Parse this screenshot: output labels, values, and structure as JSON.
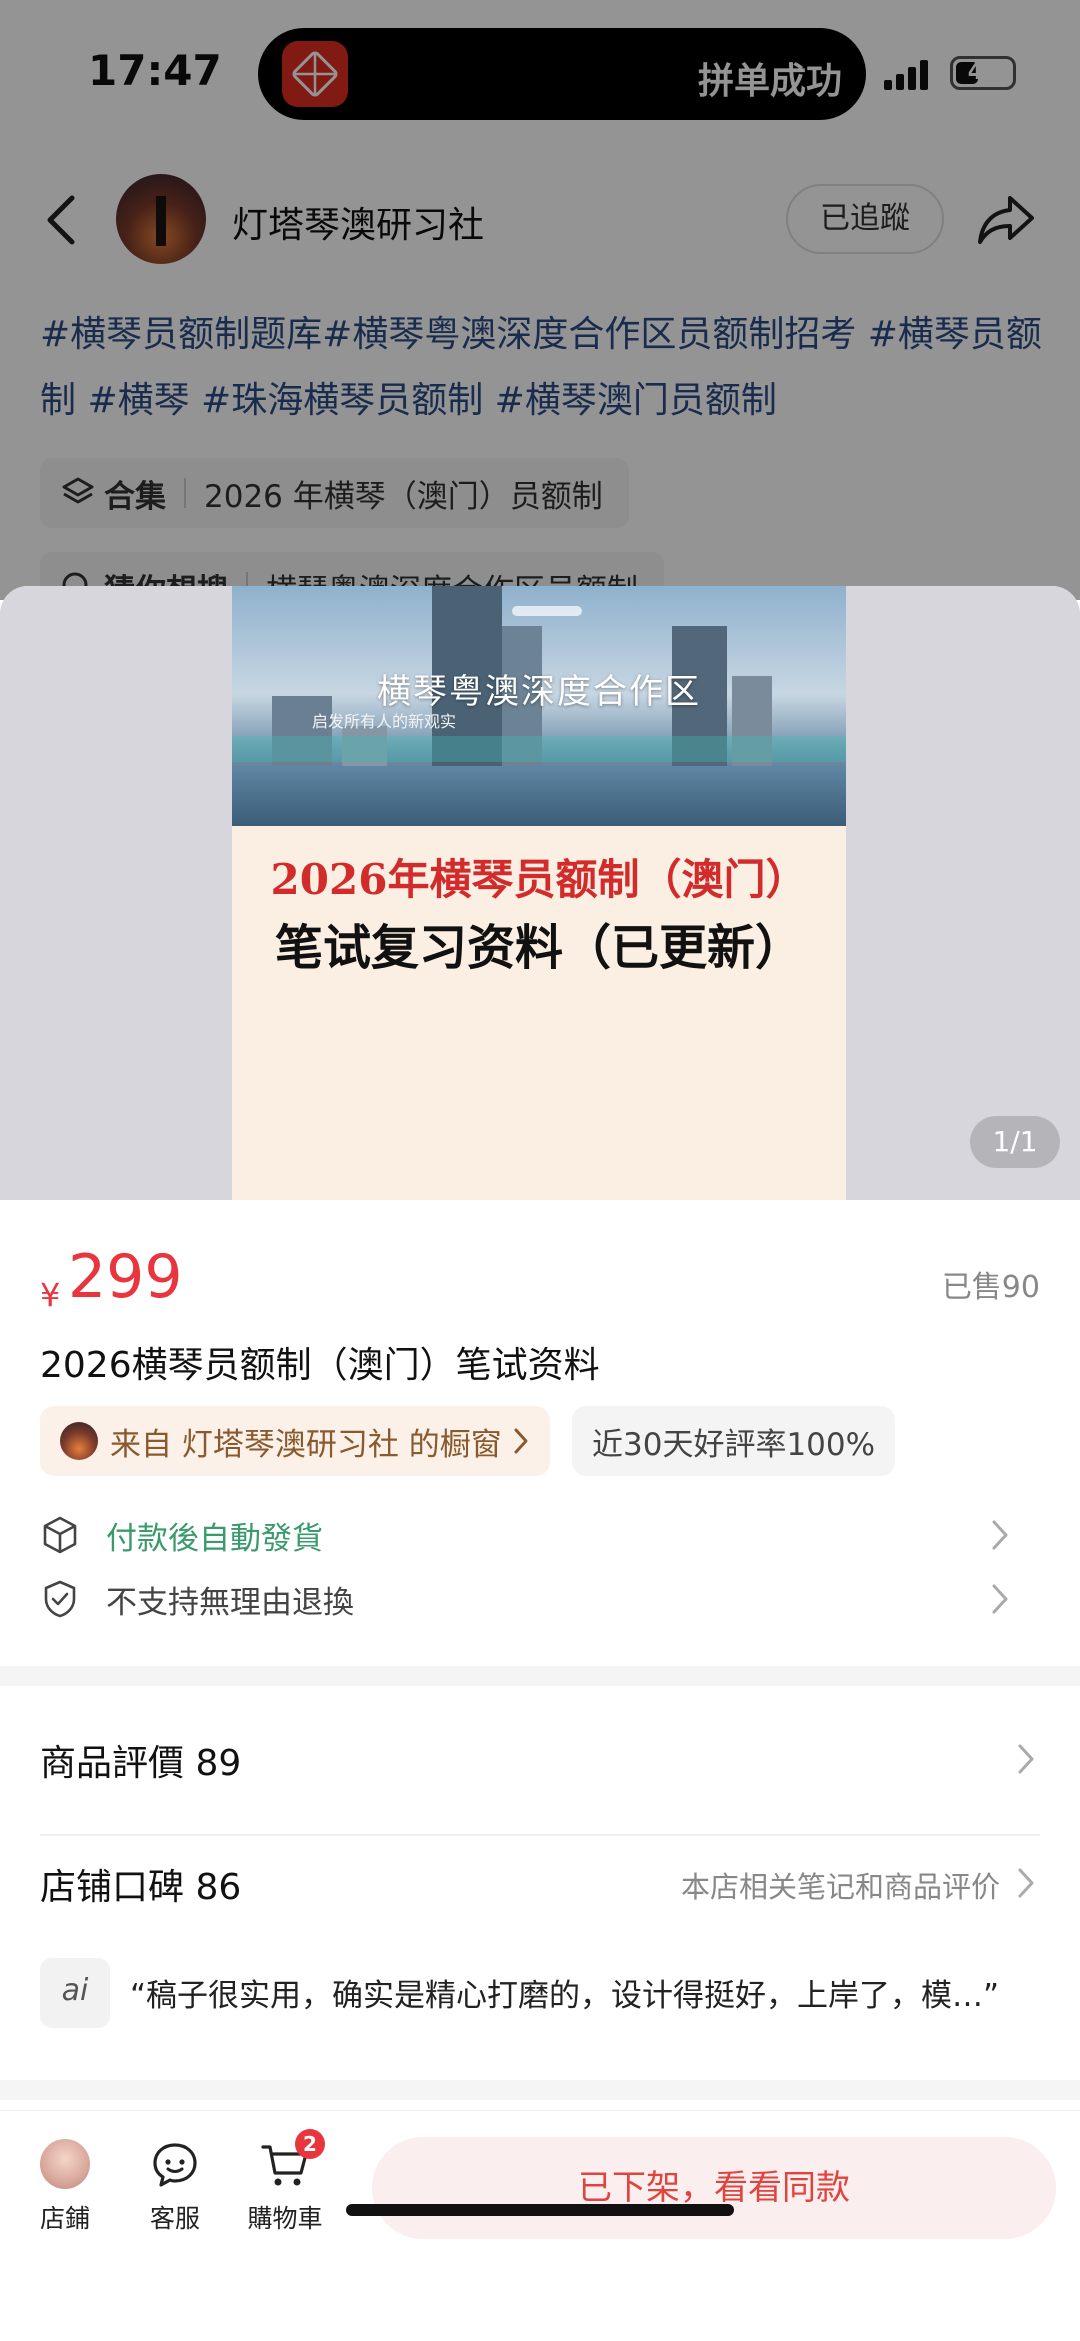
{
  "status_bar": {
    "time": "17:47",
    "island_text": "拼单成功",
    "battery": "41",
    "battery_level": 0.41
  },
  "post_header": {
    "author_name": "灯塔琴澳研习社",
    "follow_label": "已追蹤"
  },
  "post": {
    "hashtags": "#横琴员额制题库#横琴粤澳深度合作区员额制招考 #横琴员额制 #横琴 #珠海横琴员额制 #横琴澳门员额制",
    "collection_label": "合集",
    "collection_value": "2026 年横琴（澳门）员额制",
    "guess_label": "猜你想搜",
    "guess_value": "横琴粤澳深度合作区员额制"
  },
  "gallery": {
    "cover_banner": "横琴粤澳深度合作区",
    "cover_sub": "启发所有人的新观实",
    "cover_title_red": "2026年横琴员额制（澳门）",
    "cover_title_black": "笔试复习资料（已更新）",
    "page_indicator": "1/1"
  },
  "product": {
    "currency": "¥",
    "price": "299",
    "sold": "已售90",
    "title": "2026横琴员额制（澳门）笔试资料",
    "store_chip": "来自 灯塔琴澳研习社 的橱窗",
    "rating_chip": "近30天好評率100%",
    "service_auto_ship": "付款後自動發貨",
    "service_no_return": "不支持無理由退換",
    "accent_green": "#3a9a6c",
    "accent_red": "#e8353e"
  },
  "reviews": {
    "product_reviews_label": "商品評價 89",
    "store_reputation_label": "店铺口碑 86",
    "store_reputation_link": "本店相关笔记和商品评价",
    "ai_badge": "ai",
    "quote": "“稿子很实用，确实是精心打磨的，设计得挺好，上岸了，模…”"
  },
  "bottom_bar": {
    "shop_label": "店鋪",
    "service_label": "客服",
    "cart_label": "購物車",
    "cart_count": "2",
    "cta_label": "已下架，看看同款"
  },
  "icons": {
    "back": "chevron-left-icon",
    "share": "share-icon",
    "collection": "layers-icon",
    "guess": "search-icon",
    "auto_ship": "box-icon",
    "no_return": "shield-check-icon",
    "service": "chat-icon",
    "cart": "cart-icon"
  }
}
